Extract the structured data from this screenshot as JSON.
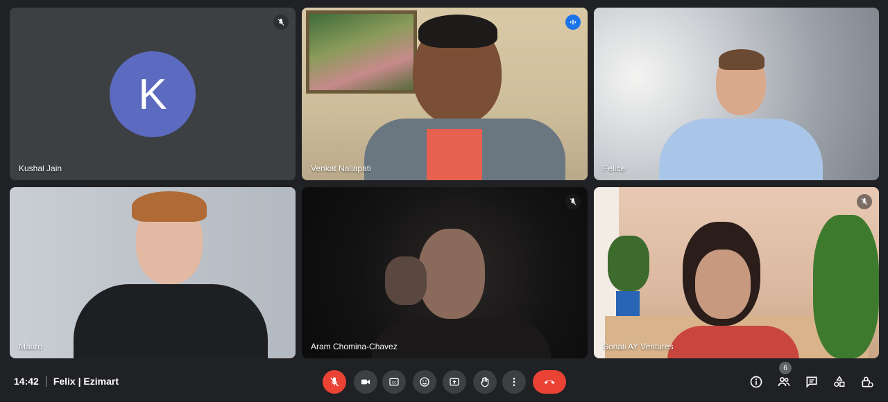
{
  "participants": [
    {
      "name": "Kushal Jain",
      "avatar_letter": "K",
      "muted": true
    },
    {
      "name": "Venkat Nallapati",
      "speaking": true
    },
    {
      "name": "Felice"
    },
    {
      "name": "Mauro"
    },
    {
      "name": "Aram Chomina-Chavez",
      "muted": true
    },
    {
      "name": "Sonali AY Ventures",
      "muted": true
    }
  ],
  "bottom_bar": {
    "time": "14:42",
    "meeting_name": "Felix | Ezimart",
    "participant_count": "6"
  },
  "colors": {
    "background": "#202124",
    "tile": "#3c4043",
    "avatar": "#5c6bc0",
    "end_call": "#ea4335",
    "speaking_outline": "#8ab4f8"
  },
  "icons": [
    "mic-off-icon",
    "camera-icon",
    "captions-icon",
    "emoji-icon",
    "present-icon",
    "raise-hand-icon",
    "more-options-icon",
    "end-call-icon",
    "info-icon",
    "people-icon",
    "chat-icon",
    "activities-icon",
    "host-controls-icon"
  ]
}
